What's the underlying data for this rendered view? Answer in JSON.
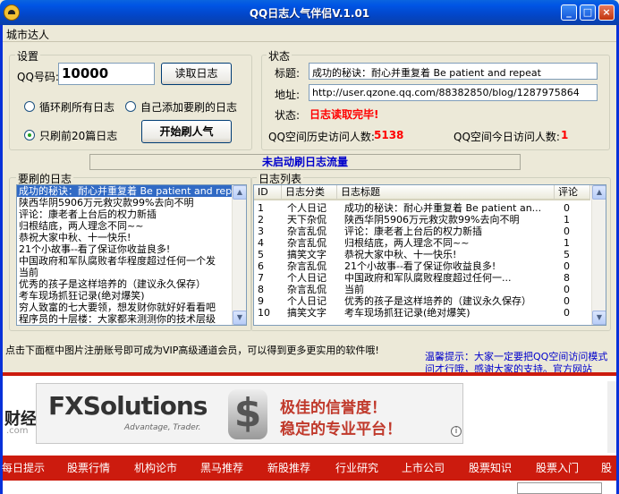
{
  "window": {
    "title": "QQ日志人气伴侣V.1.01"
  },
  "menu": {
    "item": "城市达人"
  },
  "settings": {
    "group_label": "设置",
    "qq_label": "QQ号码:",
    "qq_value": "10000",
    "read_button": "读取日志",
    "radio_loop": "循环刷所有日志",
    "radio_custom": "自己添加要刷的日志",
    "radio_recent": "只刷前20篇日志",
    "start_button": "开始刷人气"
  },
  "status": {
    "group_label": "状态",
    "title_label": "标题:",
    "title_value": "成功的秘诀：耐心并重复着  Be patient and repeat",
    "url_label": "地址:",
    "url_value": "http://user.qzone.qq.com/88382850/blog/1287975864",
    "state_label": "状态:",
    "state_value": "日志读取完毕!",
    "history_label": "QQ空间历史访问人数:",
    "history_value": "5138",
    "today_label": "QQ空间今日访问人数:",
    "today_value": "1"
  },
  "banner_status": "未启动刷日志流量",
  "journal": {
    "group_label": "要刷的日志",
    "items": [
      "成功的秘诀：耐心并重复着  Be patient and repeat",
      "陕西华阴5906万元救灾款99%去向不明",
      "评论：康老者上台后的权力新插",
      "归根结底，两人理念不同~~",
      "恭祝大家中秋、十一快乐!",
      "21个小故事--看了保证你收益良多!",
      "中国政府和军队腐败者华程度超过任何一个发",
      "当前",
      "优秀的孩子是这样培养的（建议永久保存）",
      "考车现场抓狂记录(绝对爆笑)",
      "穷人致富的七大要领，想发财你就好好看看吧",
      "程序员的十层楼：大家都来测测你的技术层级"
    ]
  },
  "log": {
    "group_label": "日志列表",
    "columns": [
      "ID",
      "日志分类",
      "日志标题",
      "评论"
    ],
    "rows": [
      [
        "1",
        "个人日记",
        "成功的秘诀：耐心并重复着  Be patient an...",
        "0"
      ],
      [
        "2",
        "天下杂侃",
        "陕西华阴5906万元救灾款99%去向不明",
        "1"
      ],
      [
        "3",
        "杂言乱侃",
        "评论：康老者上台后的权力新插",
        "0"
      ],
      [
        "4",
        "杂言乱侃",
        "归根结底，两人理念不同~~",
        "1"
      ],
      [
        "5",
        "搞笑文字",
        "恭祝大家中秋、十一快乐!",
        "5"
      ],
      [
        "6",
        "杂言乱侃",
        "21个小故事--看了保证你收益良多!",
        "0"
      ],
      [
        "7",
        "个人日记",
        "中国政府和军队腐败程度超过任何一...",
        "8"
      ],
      [
        "8",
        "杂言乱侃",
        "当前",
        "0"
      ],
      [
        "9",
        "个人日记",
        "优秀的孩子是这样培养的（建议永久保存）",
        "0"
      ],
      [
        "10",
        "搞笑文字",
        "考车现场抓狂记录(绝对爆笑)",
        "0"
      ]
    ]
  },
  "footer": {
    "vip_note": "点击下面框中图片注册账号即可成为VIP高级通道会员，可以得到更多更实用的软件哦!",
    "tip_line1": "温馨提示：大家一定要把QQ空间访问模式",
    "tip_line2": "问才行哦，感谢大家的支持。官方网站"
  },
  "ad": {
    "left_text": "财经",
    "left_sub": ".com",
    "fx_brand": "FXSolutions",
    "fx_tagline": "Advantage, Trader.",
    "fx_line1": "极佳的信誉度！",
    "fx_line2": "稳定的专业平台！"
  },
  "nav": {
    "items": [
      "每日提示",
      "股票行情",
      "机构论市",
      "黑马推荐",
      "新股推荐",
      "行业研究",
      "上市公司",
      "股票知识",
      "股票入门",
      "股"
    ]
  },
  "colors": {
    "accent": "#0a3fa8",
    "status_red": "#ff0000",
    "tip_blue": "#0000cc",
    "nav_red": "#cc1b0e"
  }
}
